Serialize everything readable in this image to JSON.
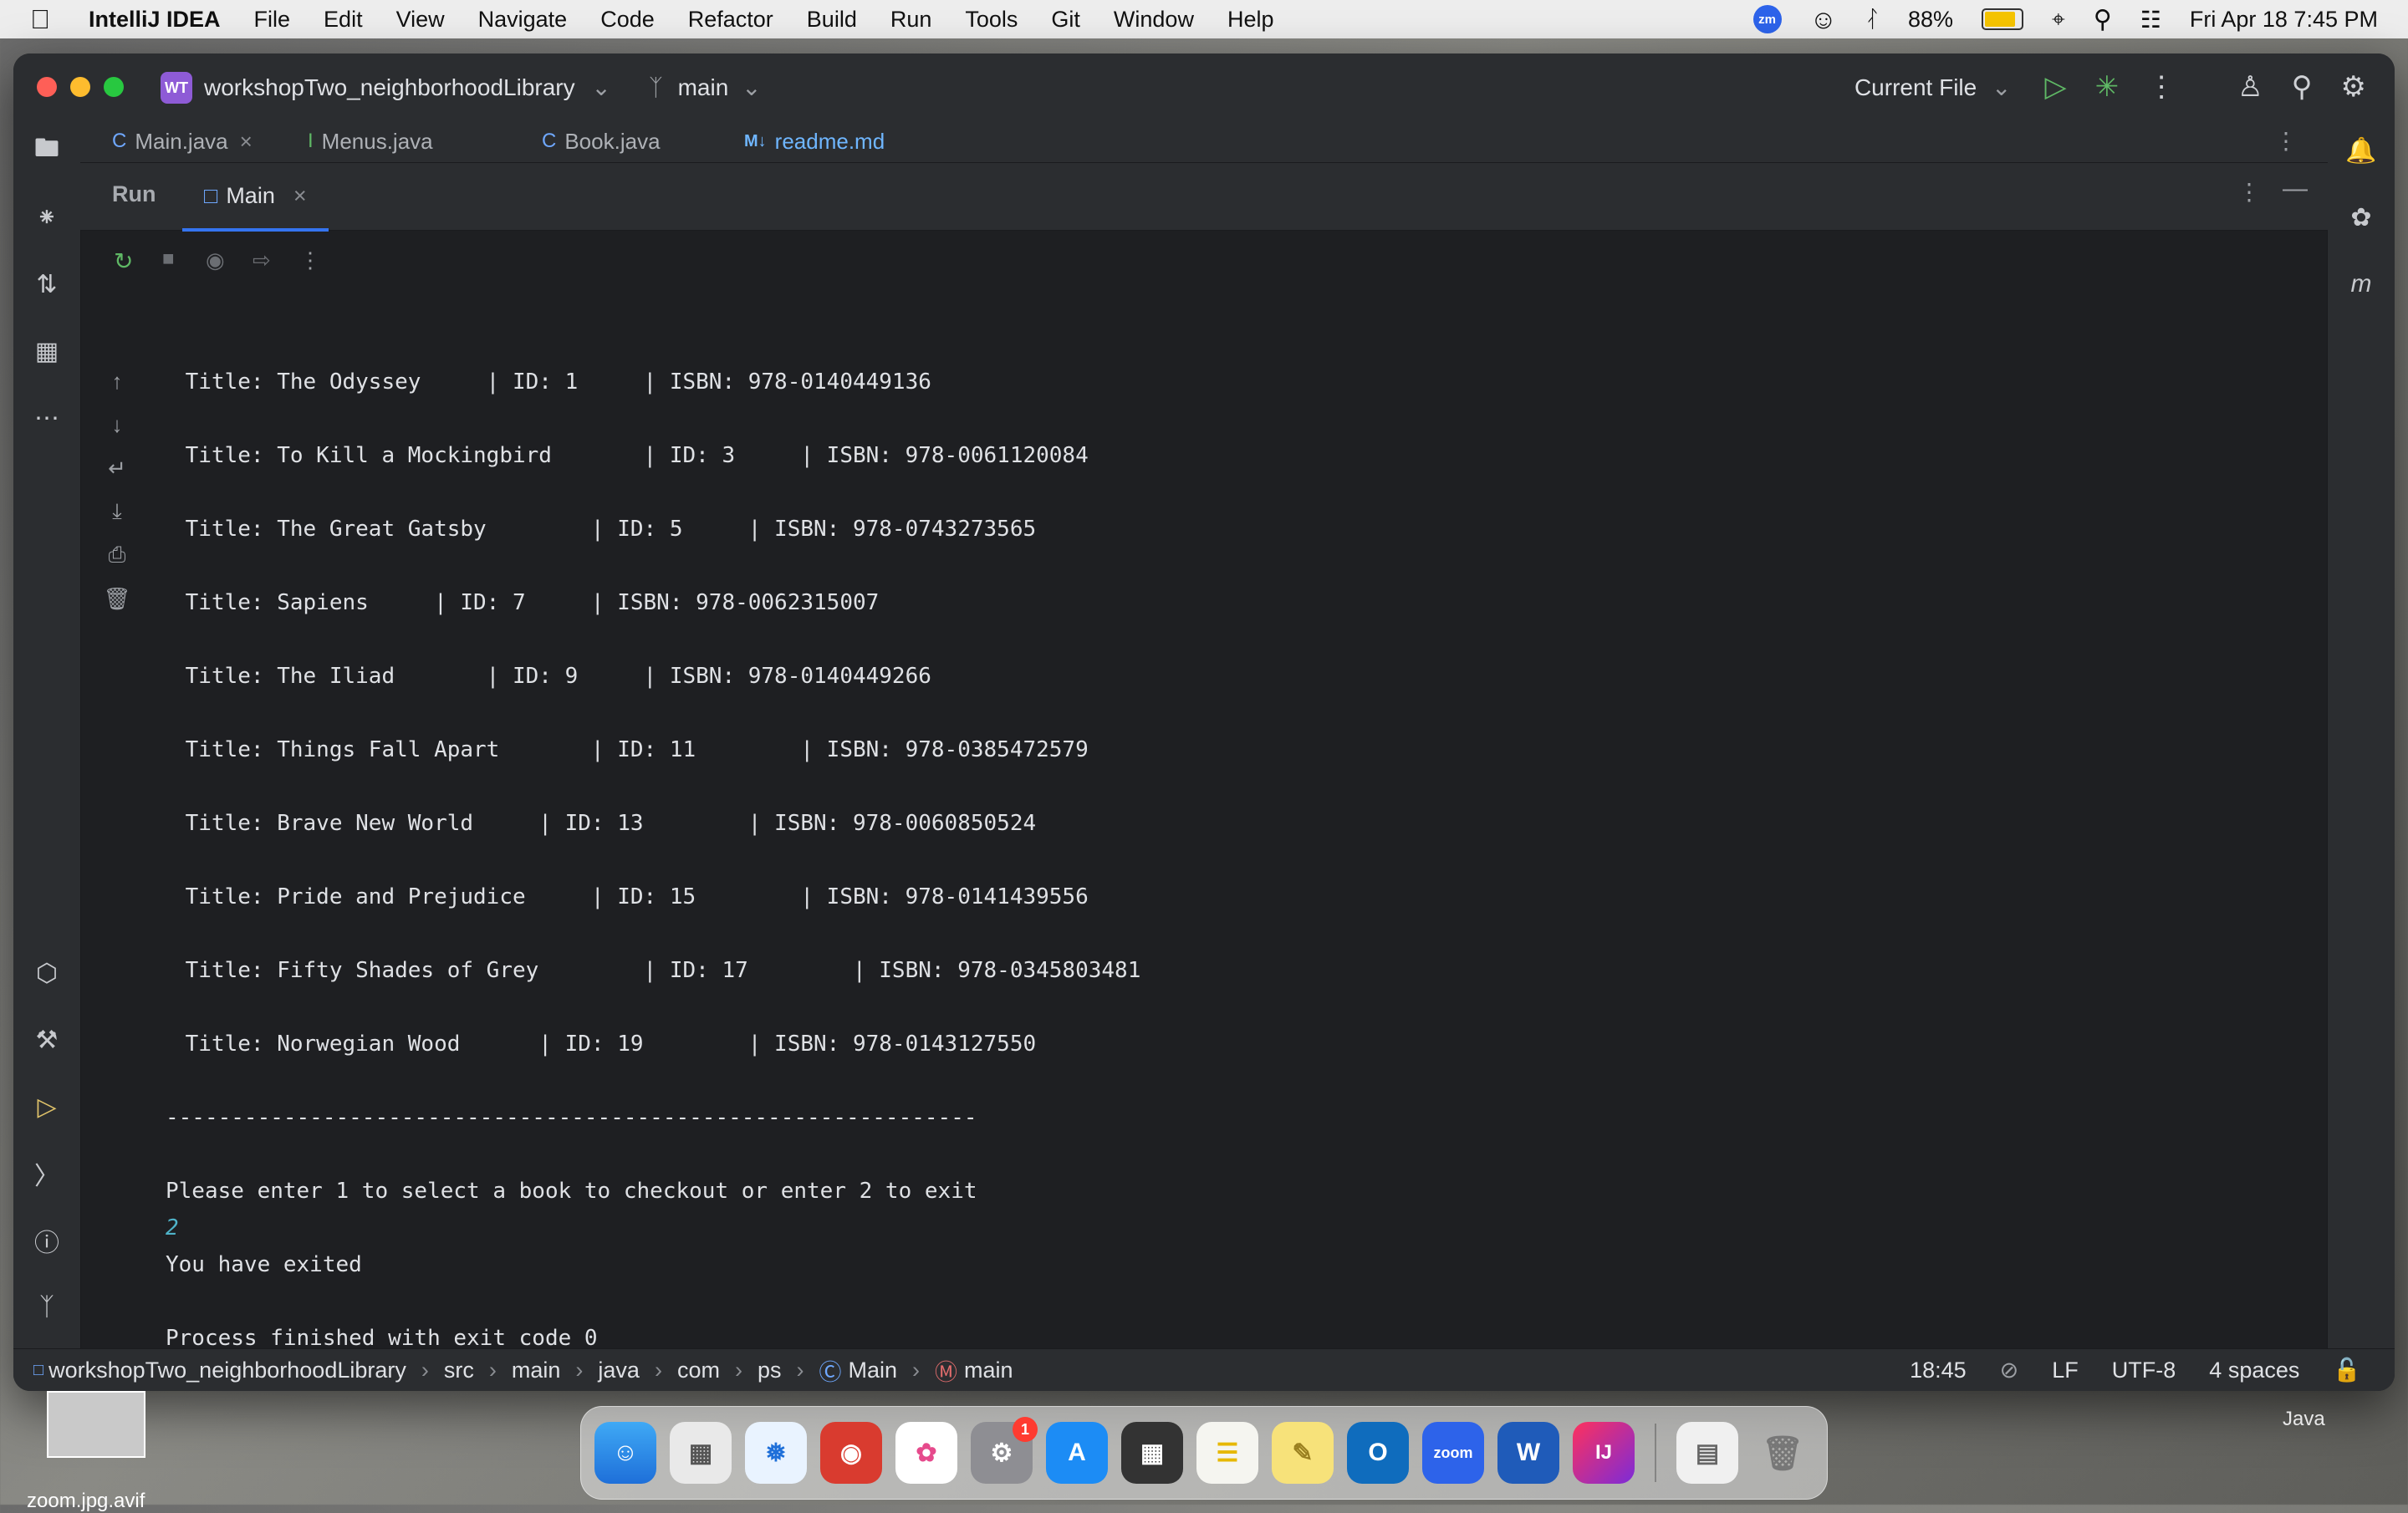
{
  "menubar": {
    "app_name": "IntelliJ IDEA",
    "menus": [
      "File",
      "Edit",
      "View",
      "Navigate",
      "Code",
      "Refactor",
      "Build",
      "Run",
      "Tools",
      "Git",
      "Window",
      "Help"
    ],
    "zoom_badge": "zm",
    "battery_percent": "88%",
    "battery_level": 0.88,
    "datetime": "Fri Apr 18  7:45 PM"
  },
  "titlebar": {
    "project_badge": "WT",
    "project_name": "workshopTwo_neighborhoodLibrary",
    "branch": "main",
    "run_config": "Current File"
  },
  "editor_tabs": [
    {
      "label": "Main.java",
      "icon": "C"
    },
    {
      "label": "Menus.java",
      "icon": "I"
    },
    {
      "label": "Book.java",
      "icon": "C"
    },
    {
      "label": "readme.md",
      "icon": "M↓"
    }
  ],
  "run_panel": {
    "label": "Run",
    "tab": "Main"
  },
  "console": {
    "lines": [
      " Title: The Odyssey     | ID: 1     | ISBN: 978-0140449136",
      " Title: To Kill a Mockingbird       | ID: 3     | ISBN: 978-0061120084",
      " Title: The Great Gatsby        | ID: 5     | ISBN: 978-0743273565",
      " Title: Sapiens     | ID: 7     | ISBN: 978-0062315007",
      " Title: The Iliad       | ID: 9     | ISBN: 978-0140449266",
      " Title: Things Fall Apart       | ID: 11        | ISBN: 978-0385472579",
      " Title: Brave New World     | ID: 13        | ISBN: 978-0060850524",
      " Title: Pride and Prejudice     | ID: 15        | ISBN: 978-0141439556",
      " Title: Fifty Shades of Grey        | ID: 17        | ISBN: 978-0345803481",
      " Title: Norwegian Wood      | ID: 19        | ISBN: 978-0143127550",
      "--------------------------------------------------------------",
      "Please enter 1 to select a book to checkout or enter 2 to exit",
      "2",
      "You have exited",
      "Process finished with exit code 0"
    ]
  },
  "statusbar": {
    "breadcrumbs": [
      "workshopTwo_neighborhoodLibrary",
      "src",
      "main",
      "java",
      "com",
      "ps",
      "Main",
      "main"
    ],
    "position": "18:45",
    "line_sep": "LF",
    "encoding": "UTF-8",
    "indent": "4 spaces"
  },
  "dock": {
    "badge_count": "1",
    "zoom_label": "zoom",
    "word_label": "W",
    "intellij_label": "IJ"
  },
  "desktop": {
    "file_label": "zoom.jpg.avif",
    "widget_label": "Java"
  }
}
